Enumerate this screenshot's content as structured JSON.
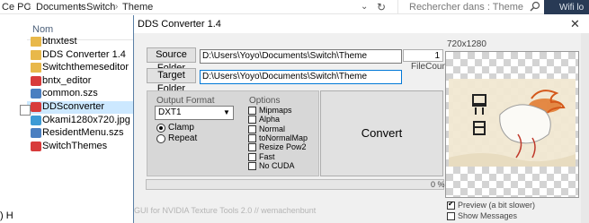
{
  "explorer": {
    "breadcrumbs": [
      "Ce PC",
      "Documents",
      "Switch",
      "Theme"
    ],
    "search_placeholder": "Rechercher dans : Theme",
    "wifi_label": "Wifi lo",
    "column_header": "Nom",
    "files": [
      {
        "name": "btnxtest",
        "icon": "folder-icon"
      },
      {
        "name": "DDS Converter 1.4",
        "icon": "folder-icon"
      },
      {
        "name": "Switchthemeseditor",
        "icon": "folder-icon"
      },
      {
        "name": "bntx_editor",
        "icon": "app-icon"
      },
      {
        "name": "common.szs",
        "icon": "file-icon"
      },
      {
        "name": "DDSconverter",
        "icon": "app-icon",
        "selected": true
      },
      {
        "name": "Okami1280x720.jpg",
        "icon": "image-icon"
      },
      {
        "name": "ResidentMenu.szs",
        "icon": "file-icon"
      },
      {
        "name": "SwitchThemes",
        "icon": "app-icon"
      }
    ],
    "left_edge_text": ") H"
  },
  "dialog": {
    "title": "DDS Converter 1.4",
    "close_glyph": "✕",
    "source_folder_label": "Source Folder",
    "source_folder_value": "D:\\Users\\Yoyo\\Documents\\Switch\\Theme",
    "target_folder_label": "Target Folder",
    "target_folder_value": "D:\\Users\\Yoyo\\Documents\\Switch\\Theme",
    "file_count_value": "1",
    "file_count_label": "FileCount",
    "output_format_label": "Output Format",
    "output_format_value": "DXT1",
    "radios": [
      {
        "label": "Clamp",
        "checked": true
      },
      {
        "label": "Repeat",
        "checked": false
      }
    ],
    "options_label": "Options",
    "options": [
      {
        "label": "Mipmaps",
        "checked": false
      },
      {
        "label": "Alpha",
        "checked": false
      },
      {
        "label": "Normal",
        "checked": false
      },
      {
        "label": "toNormalMap",
        "checked": false
      },
      {
        "label": "Resize Pow2",
        "checked": false
      },
      {
        "label": "Fast",
        "checked": false
      },
      {
        "label": "No CUDA",
        "checked": false
      }
    ],
    "convert_label": "Convert",
    "progress": 0,
    "progress_text": "0 %",
    "footer": "GUI for NVIDIA Texture Tools 2.0 // wemachenbunt",
    "preview_dimensions": "720x1280",
    "preview_checkbox": {
      "label": "Preview (a bit slower)",
      "checked": true
    },
    "show_messages_checkbox": {
      "label": "Show Messages",
      "checked": false
    }
  },
  "colors": {
    "selection": "#cce8ff",
    "window_border": "#5a7fa6",
    "wifi_panel": "#283a55"
  }
}
